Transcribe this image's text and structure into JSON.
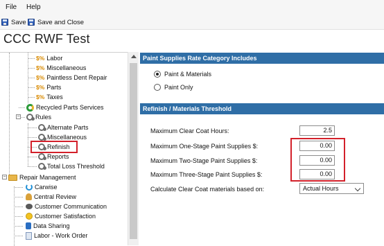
{
  "menu": {
    "file": "File",
    "help": "Help"
  },
  "toolbar": {
    "save": "Save",
    "save_close": "Save and Close"
  },
  "app_title": "CCC RWF Test",
  "tree": {
    "labor": "Labor",
    "misc1": "Miscellaneous",
    "pdr": "Paintless Dent Repair",
    "parts": "Parts",
    "taxes": "Taxes",
    "recycled": "Recycled Parts Services",
    "rules": "Rules",
    "alt_parts": "Alternate Parts",
    "misc2": "Miscellaneous",
    "refinish": "Refinish",
    "reports": "Reports",
    "total_loss": "Total Loss Threshold",
    "repair_mgmt": "Repair Management",
    "carwise": "Carwise",
    "central_review": "Central Review",
    "customer_comm": "Customer Communication",
    "customer_sat": "Customer Satisfaction",
    "data_sharing": "Data Sharing",
    "labor_work_order": "Labor - Work Order",
    "dollar_symbol": "$%"
  },
  "paint_section": {
    "header": "Paint Supplies Rate Category Includes",
    "options": [
      "Paint & Materials",
      "Paint Only"
    ],
    "selected": "Paint & Materials"
  },
  "threshold_section": {
    "header": "Refinish / Materials Threshold",
    "clear_coat_label": "Maximum Clear Coat Hours:",
    "clear_coat_value": "2.5",
    "one_stage_label": "Maximum One-Stage Paint Supplies $:",
    "one_stage_value": "0.00",
    "two_stage_label": "Maximum Two-Stage Paint Supplies $:",
    "two_stage_value": "0.00",
    "three_stage_label": "Maximum Three-Stage Paint Supplies $:",
    "three_stage_value": "0.00",
    "calc_label": "Calculate Clear Coat materials based on:",
    "calc_value": "Actual Hours"
  },
  "colors": {
    "section_header_bg": "#2f6ea6",
    "highlight": "#d3202a",
    "toolbar_bg": "#f6f6f6"
  }
}
